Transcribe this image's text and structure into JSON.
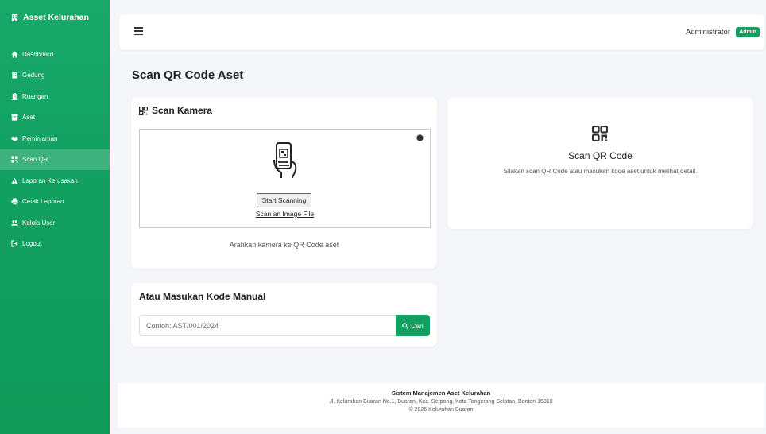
{
  "app": {
    "brand": "Asset Kelurahan"
  },
  "sidebar": {
    "items": [
      {
        "label": "Dashboard",
        "icon": "home-icon"
      },
      {
        "label": "Gedung",
        "icon": "building-icon"
      },
      {
        "label": "Ruangan",
        "icon": "door-icon"
      },
      {
        "label": "Aset",
        "icon": "box-icon"
      },
      {
        "label": "Peminjaman",
        "icon": "handshake-icon"
      },
      {
        "label": "Scan QR",
        "icon": "qrcode-icon",
        "active": true
      },
      {
        "label": "Laporan Kerusakan",
        "icon": "warning-icon"
      },
      {
        "label": "Cetak Laporan",
        "icon": "print-icon"
      },
      {
        "label": "Kelola User",
        "icon": "users-icon"
      },
      {
        "label": "Logout",
        "icon": "logout-icon"
      }
    ]
  },
  "header": {
    "user_name": "Administrator",
    "role_badge": "Admin"
  },
  "page": {
    "title": "Scan QR Code Aset"
  },
  "scan_card": {
    "title": "Scan Kamera",
    "start_button": "Start Scanning",
    "scan_file_link": "Scan an Image File",
    "hint": "Arahkan kamera ke QR Code aset"
  },
  "manual_card": {
    "title": "Atau Masukan Kode Manual",
    "placeholder": "Contoh: AST/001/2024",
    "button": "Cari"
  },
  "result_card": {
    "title": "Scan QR Code",
    "description": "Silakan scan QR Code atau masukan kode aset untuk melihat detail."
  },
  "footer": {
    "title": "Sistem Manajemen Aset Kelurahan",
    "address": "Jl. Kelurahan Buaran No.1, Buaran, Kec. Serpong, Kota Tangerang Selatan, Banten 15310",
    "copyright": "© 2026 Kelurahan Buaran"
  },
  "colors": {
    "primary": "#12a061",
    "background": "#f4f6f9"
  }
}
